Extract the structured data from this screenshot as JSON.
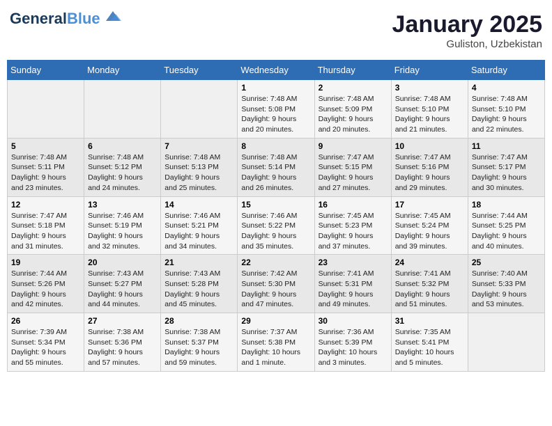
{
  "header": {
    "logo_line1": "General",
    "logo_line2": "Blue",
    "month": "January 2025",
    "location": "Guliston, Uzbekistan"
  },
  "weekdays": [
    "Sunday",
    "Monday",
    "Tuesday",
    "Wednesday",
    "Thursday",
    "Friday",
    "Saturday"
  ],
  "weeks": [
    [
      {
        "day": "",
        "info": ""
      },
      {
        "day": "",
        "info": ""
      },
      {
        "day": "",
        "info": ""
      },
      {
        "day": "1",
        "info": "Sunrise: 7:48 AM\nSunset: 5:08 PM\nDaylight: 9 hours and 20 minutes."
      },
      {
        "day": "2",
        "info": "Sunrise: 7:48 AM\nSunset: 5:09 PM\nDaylight: 9 hours and 20 minutes."
      },
      {
        "day": "3",
        "info": "Sunrise: 7:48 AM\nSunset: 5:10 PM\nDaylight: 9 hours and 21 minutes."
      },
      {
        "day": "4",
        "info": "Sunrise: 7:48 AM\nSunset: 5:10 PM\nDaylight: 9 hours and 22 minutes."
      }
    ],
    [
      {
        "day": "5",
        "info": "Sunrise: 7:48 AM\nSunset: 5:11 PM\nDaylight: 9 hours and 23 minutes."
      },
      {
        "day": "6",
        "info": "Sunrise: 7:48 AM\nSunset: 5:12 PM\nDaylight: 9 hours and 24 minutes."
      },
      {
        "day": "7",
        "info": "Sunrise: 7:48 AM\nSunset: 5:13 PM\nDaylight: 9 hours and 25 minutes."
      },
      {
        "day": "8",
        "info": "Sunrise: 7:48 AM\nSunset: 5:14 PM\nDaylight: 9 hours and 26 minutes."
      },
      {
        "day": "9",
        "info": "Sunrise: 7:47 AM\nSunset: 5:15 PM\nDaylight: 9 hours and 27 minutes."
      },
      {
        "day": "10",
        "info": "Sunrise: 7:47 AM\nSunset: 5:16 PM\nDaylight: 9 hours and 29 minutes."
      },
      {
        "day": "11",
        "info": "Sunrise: 7:47 AM\nSunset: 5:17 PM\nDaylight: 9 hours and 30 minutes."
      }
    ],
    [
      {
        "day": "12",
        "info": "Sunrise: 7:47 AM\nSunset: 5:18 PM\nDaylight: 9 hours and 31 minutes."
      },
      {
        "day": "13",
        "info": "Sunrise: 7:46 AM\nSunset: 5:19 PM\nDaylight: 9 hours and 32 minutes."
      },
      {
        "day": "14",
        "info": "Sunrise: 7:46 AM\nSunset: 5:21 PM\nDaylight: 9 hours and 34 minutes."
      },
      {
        "day": "15",
        "info": "Sunrise: 7:46 AM\nSunset: 5:22 PM\nDaylight: 9 hours and 35 minutes."
      },
      {
        "day": "16",
        "info": "Sunrise: 7:45 AM\nSunset: 5:23 PM\nDaylight: 9 hours and 37 minutes."
      },
      {
        "day": "17",
        "info": "Sunrise: 7:45 AM\nSunset: 5:24 PM\nDaylight: 9 hours and 39 minutes."
      },
      {
        "day": "18",
        "info": "Sunrise: 7:44 AM\nSunset: 5:25 PM\nDaylight: 9 hours and 40 minutes."
      }
    ],
    [
      {
        "day": "19",
        "info": "Sunrise: 7:44 AM\nSunset: 5:26 PM\nDaylight: 9 hours and 42 minutes."
      },
      {
        "day": "20",
        "info": "Sunrise: 7:43 AM\nSunset: 5:27 PM\nDaylight: 9 hours and 44 minutes."
      },
      {
        "day": "21",
        "info": "Sunrise: 7:43 AM\nSunset: 5:28 PM\nDaylight: 9 hours and 45 minutes."
      },
      {
        "day": "22",
        "info": "Sunrise: 7:42 AM\nSunset: 5:30 PM\nDaylight: 9 hours and 47 minutes."
      },
      {
        "day": "23",
        "info": "Sunrise: 7:41 AM\nSunset: 5:31 PM\nDaylight: 9 hours and 49 minutes."
      },
      {
        "day": "24",
        "info": "Sunrise: 7:41 AM\nSunset: 5:32 PM\nDaylight: 9 hours and 51 minutes."
      },
      {
        "day": "25",
        "info": "Sunrise: 7:40 AM\nSunset: 5:33 PM\nDaylight: 9 hours and 53 minutes."
      }
    ],
    [
      {
        "day": "26",
        "info": "Sunrise: 7:39 AM\nSunset: 5:34 PM\nDaylight: 9 hours and 55 minutes."
      },
      {
        "day": "27",
        "info": "Sunrise: 7:38 AM\nSunset: 5:36 PM\nDaylight: 9 hours and 57 minutes."
      },
      {
        "day": "28",
        "info": "Sunrise: 7:38 AM\nSunset: 5:37 PM\nDaylight: 9 hours and 59 minutes."
      },
      {
        "day": "29",
        "info": "Sunrise: 7:37 AM\nSunset: 5:38 PM\nDaylight: 10 hours and 1 minute."
      },
      {
        "day": "30",
        "info": "Sunrise: 7:36 AM\nSunset: 5:39 PM\nDaylight: 10 hours and 3 minutes."
      },
      {
        "day": "31",
        "info": "Sunrise: 7:35 AM\nSunset: 5:41 PM\nDaylight: 10 hours and 5 minutes."
      },
      {
        "day": "",
        "info": ""
      }
    ]
  ]
}
